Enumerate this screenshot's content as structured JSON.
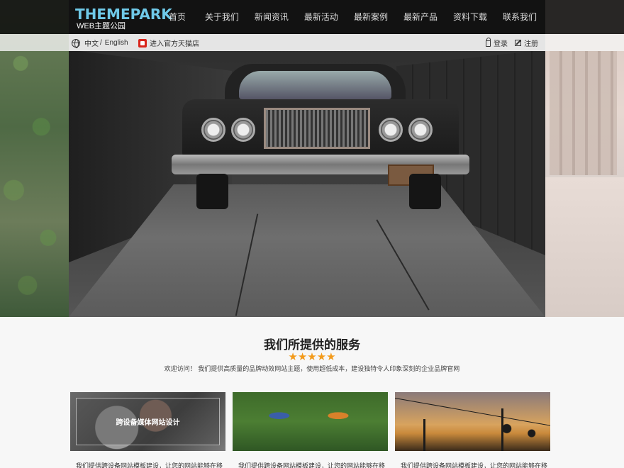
{
  "brand": {
    "title": "THEMEPARK",
    "subtitle": "WEB主题公园"
  },
  "nav": {
    "items": [
      "首页",
      "关于我们",
      "新闻资讯",
      "最新活动",
      "最新案例",
      "最新产品",
      "资料下载",
      "联系我们"
    ]
  },
  "subbar": {
    "lang_cn": "中文",
    "lang_sep": "/",
    "lang_en": "English",
    "tmall": "进入官方天猫店",
    "login": "登录",
    "register": "注册"
  },
  "icons": [
    "globe-icon",
    "tmall-icon",
    "lock-icon",
    "edit-icon"
  ],
  "colors": {
    "brand_accent": "#6fc9e8",
    "star": "#f39a1a",
    "nav_bg": "#0f0f0f",
    "tmall_red": "#d9261c"
  },
  "services": {
    "title": "我们所提供的服务",
    "stars": "★★★★★",
    "description": "欢迎访问！ 我们提供高质量的品牌动效网站主题，使用超低成本，建设独特令人印象深刻的企业品牌官网",
    "cards": [
      {
        "overlay": "跨设备媒体网站设计",
        "caption": "我们提供跨设备网站模板建设，让您的网站能够在移"
      },
      {
        "overlay": "",
        "caption": "我们提供跨设备网站模板建设，让您的网站能够在移"
      },
      {
        "overlay": "",
        "caption": "我们提供跨设备网站模板建设，让您的网站能够在移"
      }
    ]
  }
}
